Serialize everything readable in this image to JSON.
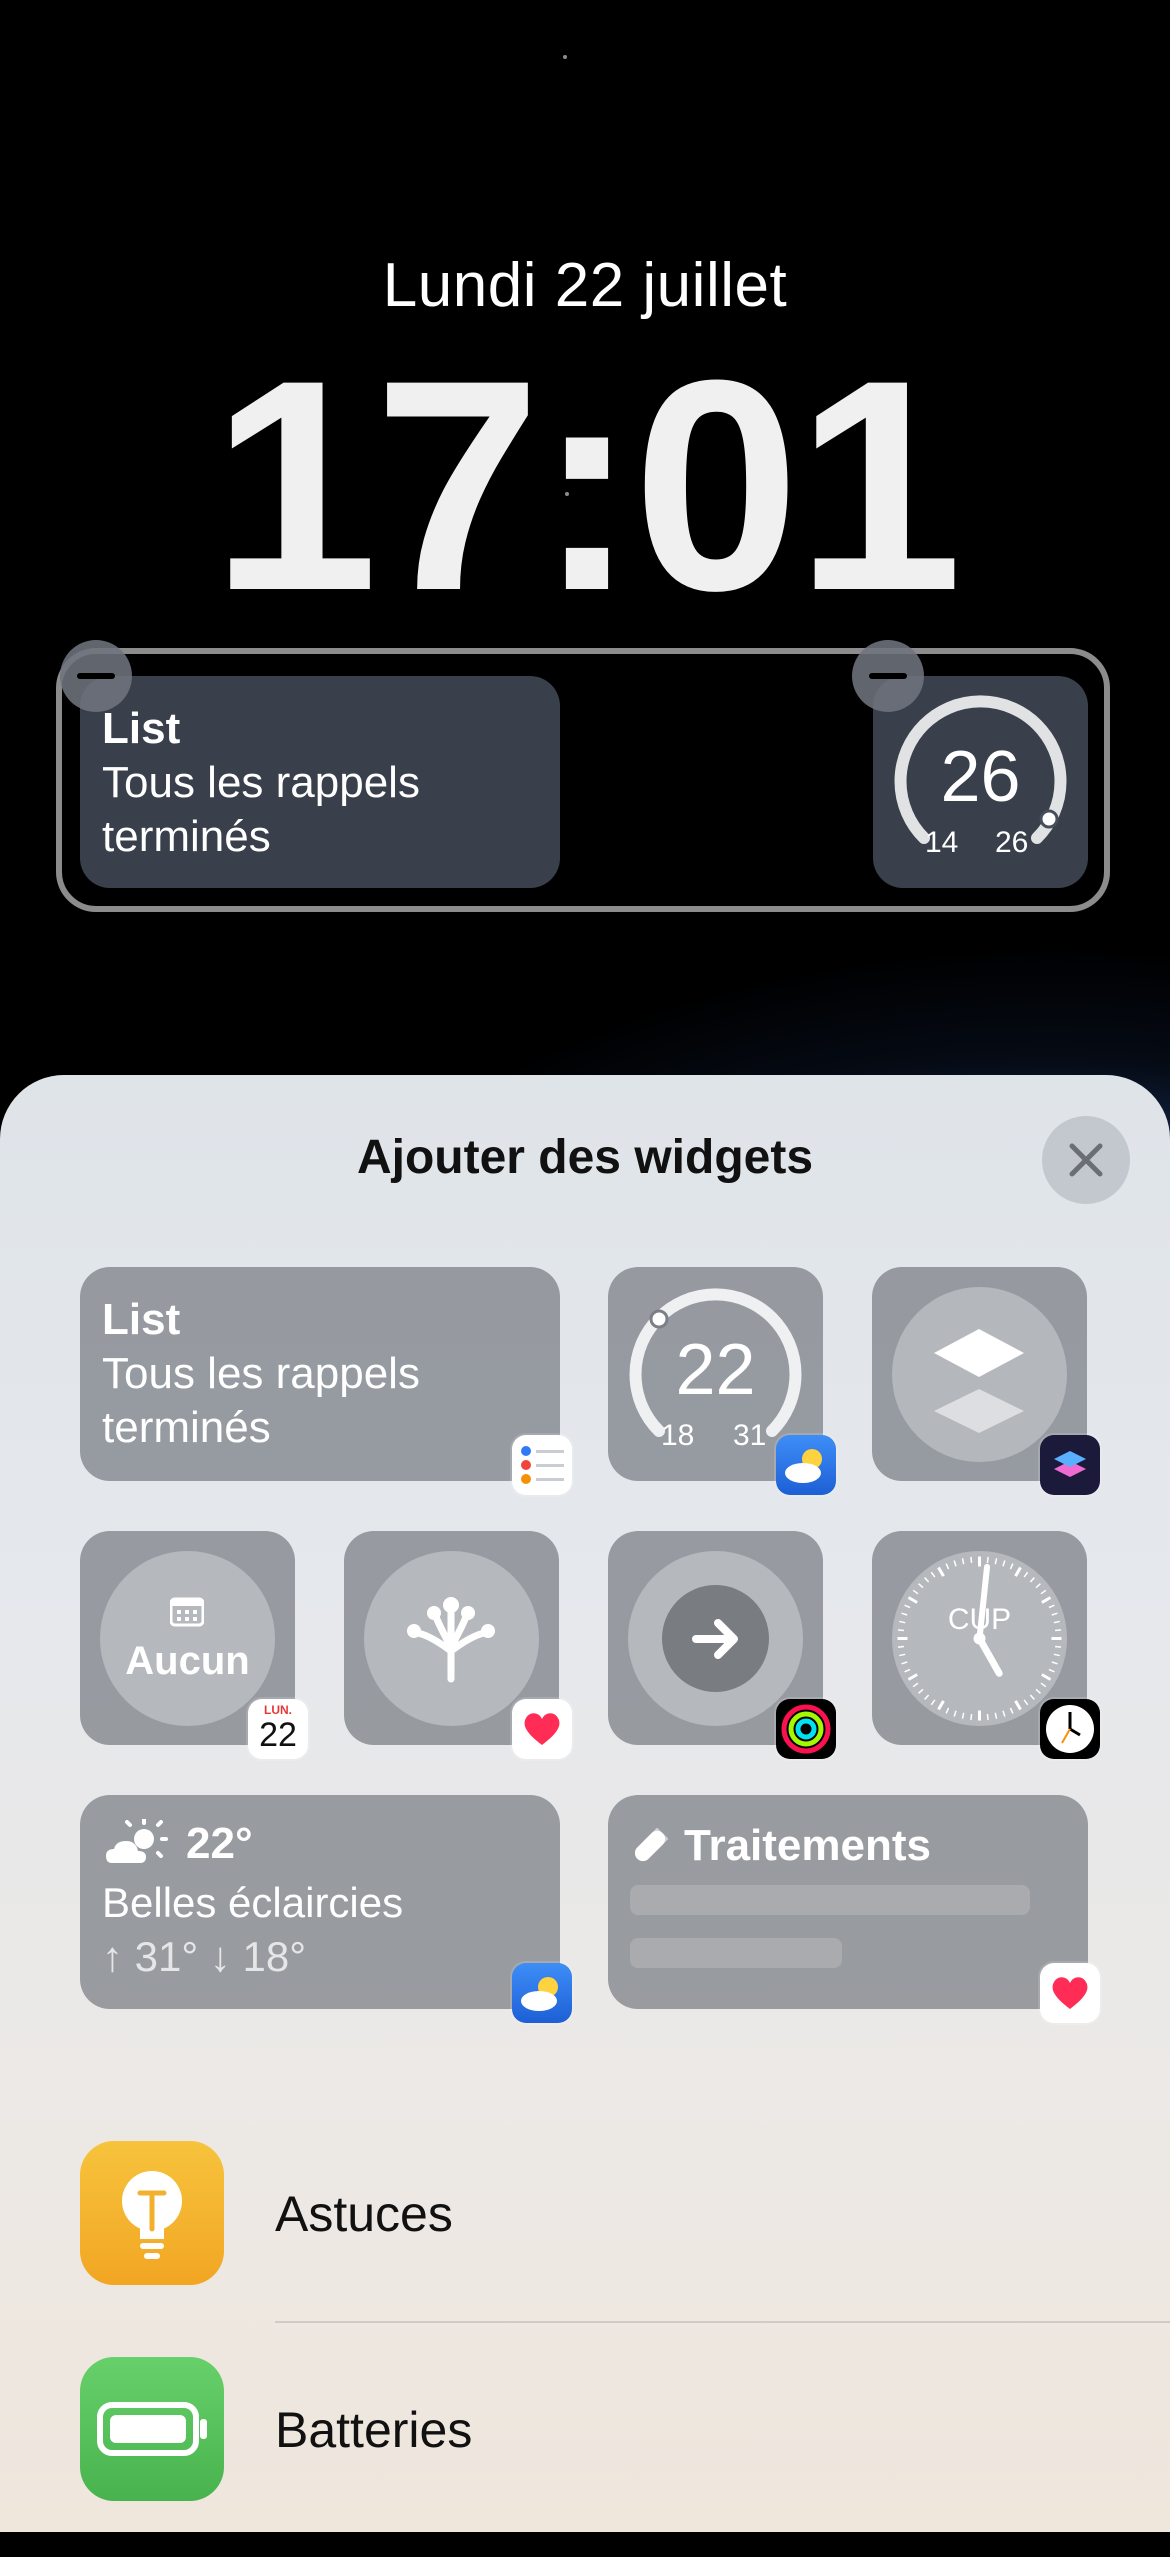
{
  "lock_screen": {
    "date": "Lundi 22 juillet",
    "time": "17:01",
    "widgets": {
      "list": {
        "title": "List",
        "subtitle": "Tous les rappels terminés"
      },
      "temperature_gauge": {
        "current": "26",
        "low": "14",
        "high": "26",
        "level": 1.0
      }
    }
  },
  "sheet": {
    "title": "Ajouter des widgets",
    "suggestions": {
      "list": {
        "title": "List",
        "subtitle": "Tous les rappels terminés",
        "app_icon": "reminders-icon"
      },
      "temperature_gauge": {
        "current": "22",
        "low": "18",
        "high": "31",
        "level": 0.3,
        "app_icon": "weather-icon"
      },
      "shortcuts": {
        "symbol": "shortcuts-icon",
        "app_icon": "shortcuts-app-icon"
      },
      "calendar": {
        "label": "Aucun",
        "badge_day": "LUN.",
        "badge_date": "22"
      },
      "health": {
        "symbol": "health-tree-icon",
        "app_icon": "health-heart-icon"
      },
      "activity": {
        "symbol": "arrow-right-icon",
        "app_icon": "activity-rings-icon"
      },
      "clock": {
        "label": "CUP",
        "hour": 5,
        "minute": 1,
        "app_icon": "clock-app-icon"
      },
      "weather": {
        "temperature": "22°",
        "condition": "Belles éclaircies",
        "high_low": "↑ 31° ↓ 18°",
        "app_icon": "weather-icon"
      },
      "medications": {
        "title": "Traitements",
        "app_icon": "health-heart-icon"
      }
    },
    "apps": [
      {
        "name": "Astuces",
        "icon": "tips-lightbulb-icon",
        "color": "#f3b52f"
      },
      {
        "name": "Batteries",
        "icon": "battery-icon",
        "color": "#5ac35f"
      }
    ]
  }
}
